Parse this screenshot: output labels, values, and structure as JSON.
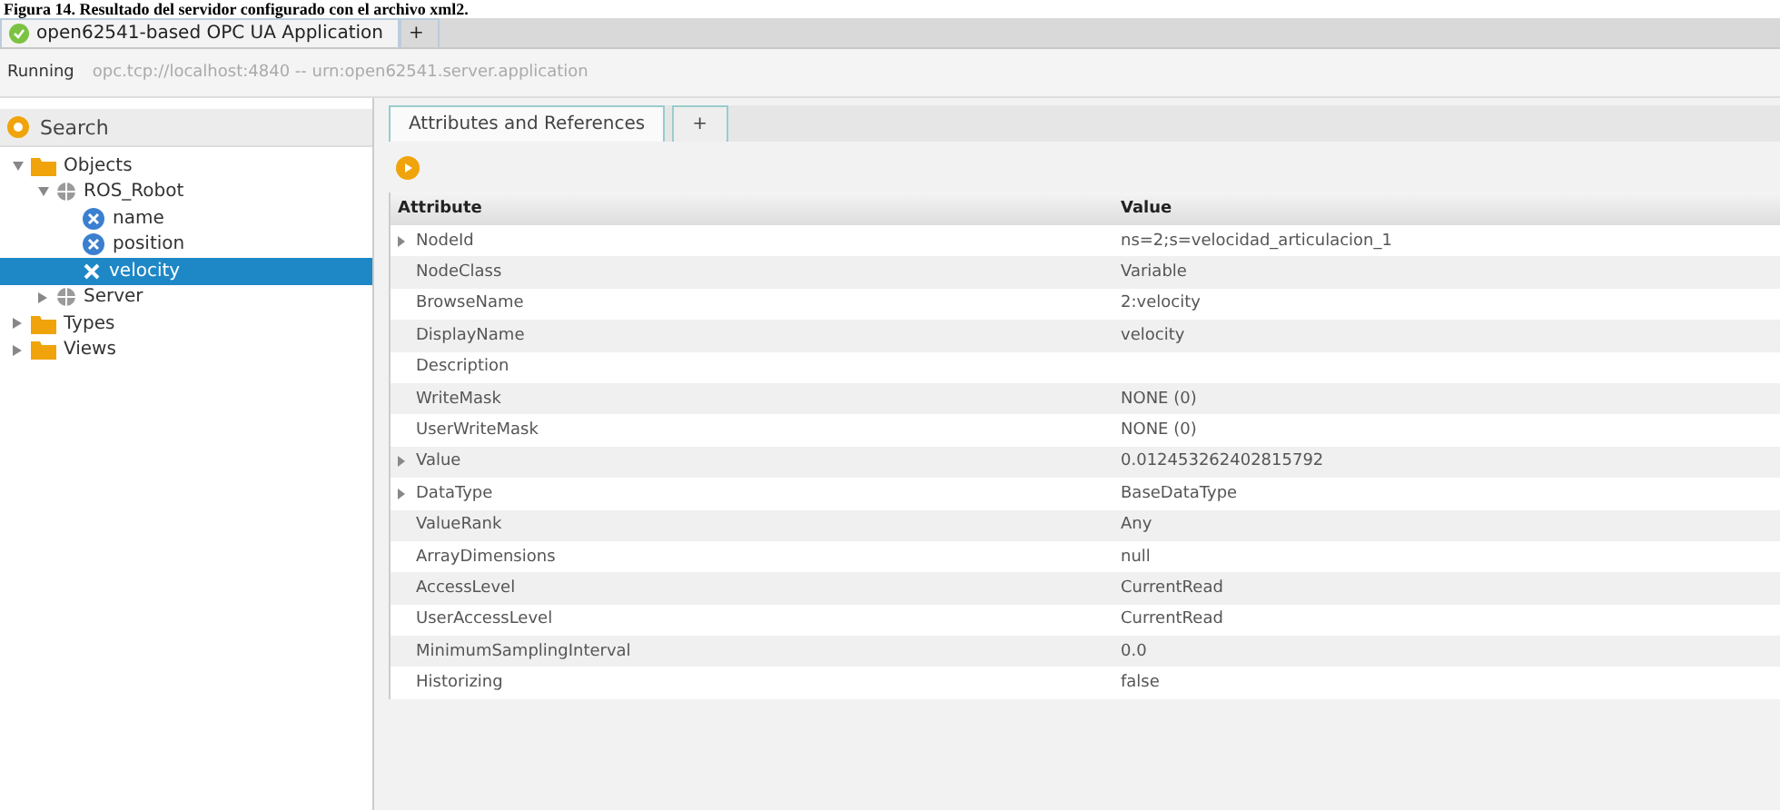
{
  "caption": "Figura 14. Resultado del servidor configurado con el archivo xml2.",
  "window": {
    "tabs": [
      {
        "label": "open62541-based OPC UA Application",
        "selected": true
      },
      {
        "label": "+",
        "selected": false
      }
    ]
  },
  "status": {
    "state": "Running",
    "endpoint": "opc.tcp://localhost:4840 -- urn:open62541.server.application"
  },
  "sidebar": {
    "search": {
      "placeholder": "Search"
    },
    "tree": [
      {
        "label": "Objects",
        "kind": "folder",
        "expanded": true,
        "selected": false,
        "children": [
          {
            "label": "ROS_Robot",
            "kind": "object",
            "expanded": true,
            "selected": false,
            "children": [
              {
                "label": "name",
                "kind": "variable",
                "selected": false
              },
              {
                "label": "position",
                "kind": "variable",
                "selected": false
              },
              {
                "label": "velocity",
                "kind": "variable",
                "selected": true
              }
            ]
          },
          {
            "label": "Server",
            "kind": "object",
            "expanded": false,
            "selected": false
          }
        ]
      },
      {
        "label": "Types",
        "kind": "folder",
        "expanded": false,
        "selected": false
      },
      {
        "label": "Views",
        "kind": "folder",
        "expanded": false,
        "selected": false
      }
    ]
  },
  "panel": {
    "tabs": [
      {
        "label": "Attributes and References",
        "selected": true
      },
      {
        "label": "+",
        "selected": false
      }
    ],
    "table": {
      "columns": [
        "Attribute",
        "Value"
      ],
      "rows": [
        {
          "attribute": "NodeId",
          "value": "ns=2;s=velocidad_articulacion_1",
          "expandable": true
        },
        {
          "attribute": "NodeClass",
          "value": "Variable",
          "expandable": false
        },
        {
          "attribute": "BrowseName",
          "value": "2:velocity",
          "expandable": false
        },
        {
          "attribute": "DisplayName",
          "value": "velocity",
          "expandable": false
        },
        {
          "attribute": "Description",
          "value": "",
          "expandable": false
        },
        {
          "attribute": "WriteMask",
          "value": "NONE  (0)",
          "expandable": false
        },
        {
          "attribute": "UserWriteMask",
          "value": "NONE  (0)",
          "expandable": false
        },
        {
          "attribute": "Value",
          "value": "0.012453262402815792",
          "expandable": true
        },
        {
          "attribute": "DataType",
          "value": "BaseDataType",
          "expandable": true
        },
        {
          "attribute": "ValueRank",
          "value": "Any",
          "expandable": false
        },
        {
          "attribute": "ArrayDimensions",
          "value": "null",
          "expandable": false
        },
        {
          "attribute": "AccessLevel",
          "value": "CurrentRead",
          "expandable": false
        },
        {
          "attribute": "UserAccessLevel",
          "value": "CurrentRead",
          "expandable": false
        },
        {
          "attribute": "MinimumSamplingInterval",
          "value": "0.0",
          "expandable": false
        },
        {
          "attribute": "Historizing",
          "value": "false",
          "expandable": false
        }
      ]
    }
  }
}
